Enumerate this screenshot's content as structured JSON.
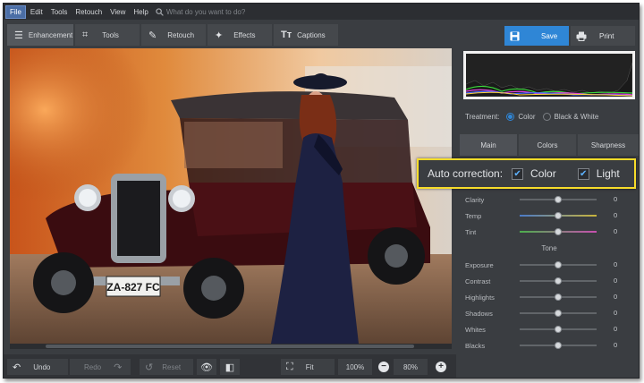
{
  "menu": {
    "items": [
      "File",
      "Edit",
      "Tools",
      "Retouch",
      "View",
      "Help"
    ],
    "search_placeholder": "What do you want to do?"
  },
  "toolbar": {
    "tabs": [
      "Enhancement",
      "Tools",
      "Retouch",
      "Effects",
      "Captions"
    ],
    "save_label": "Save",
    "print_label": "Print"
  },
  "photo": {
    "license_plate": "ZA-827 FC"
  },
  "bottom_bar": {
    "undo_label": "Undo",
    "redo_label": "Redo",
    "reset_label": "Reset",
    "fit_label": "Fit",
    "zoom_100": "100%",
    "zoom_current": "80%"
  },
  "panel": {
    "treatment_label": "Treatment:",
    "treatment_options": [
      "Color",
      "Black & White"
    ],
    "tabs": [
      "Main",
      "Colors",
      "Sharpness"
    ],
    "auto_correction": {
      "label": "Auto correction:",
      "options": [
        "Color",
        "Light"
      ]
    },
    "color_sliders": [
      {
        "label": "Clarity",
        "value": "0",
        "level": 0.5
      },
      {
        "label": "Temp",
        "value": "0",
        "level": 0.5
      },
      {
        "label": "Tint",
        "value": "0",
        "level": 0.5
      }
    ],
    "tone_title": "Tone",
    "tone_sliders": [
      {
        "label": "Exposure",
        "value": "0",
        "level": 0.5
      },
      {
        "label": "Contrast",
        "value": "0",
        "level": 0.5
      },
      {
        "label": "Highlights",
        "value": "0",
        "level": 0.5
      },
      {
        "label": "Shadows",
        "value": "0",
        "level": 0.5
      },
      {
        "label": "Whites",
        "value": "0",
        "level": 0.5
      },
      {
        "label": "Blacks",
        "value": "0",
        "level": 0.5
      }
    ]
  },
  "colors": {
    "accent": "#2f86d6",
    "highlight": "#f7dc2a",
    "panel_bg": "#3a3d41"
  }
}
